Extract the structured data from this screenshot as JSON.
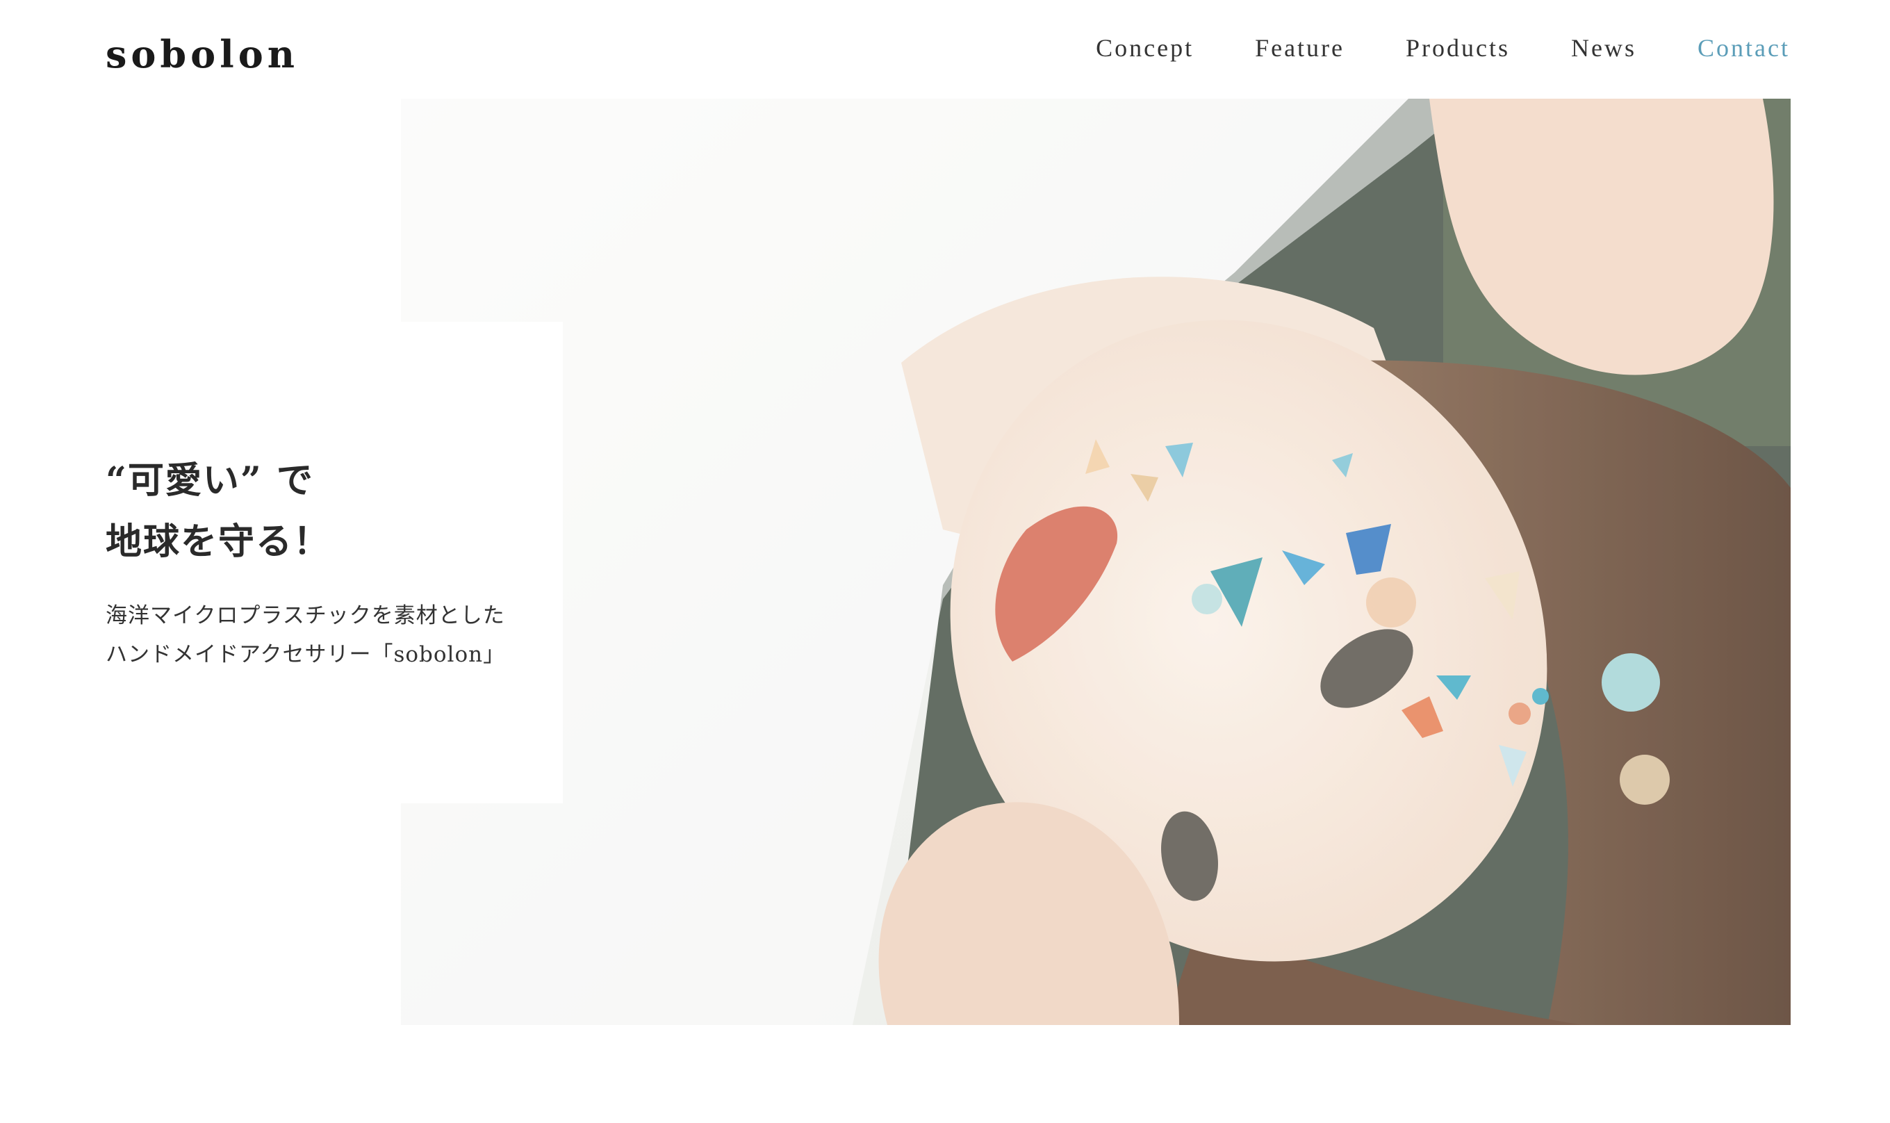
{
  "brand": {
    "logo": "sobolon"
  },
  "nav": {
    "items": [
      {
        "label": "Concept"
      },
      {
        "label": "Feature"
      },
      {
        "label": "Products"
      },
      {
        "label": "News"
      },
      {
        "label": "Contact"
      }
    ],
    "contact_color": "#5b9db8"
  },
  "hero": {
    "image": "woman-lying-on-grass-with-plastic-fragments-on-face",
    "headline": [
      "“可愛い” で",
      "地球を守る！"
    ],
    "description": [
      "海洋マイクロプラスチックを素材とした",
      "ハンドメイドアクセサリー「sobolon」"
    ]
  }
}
